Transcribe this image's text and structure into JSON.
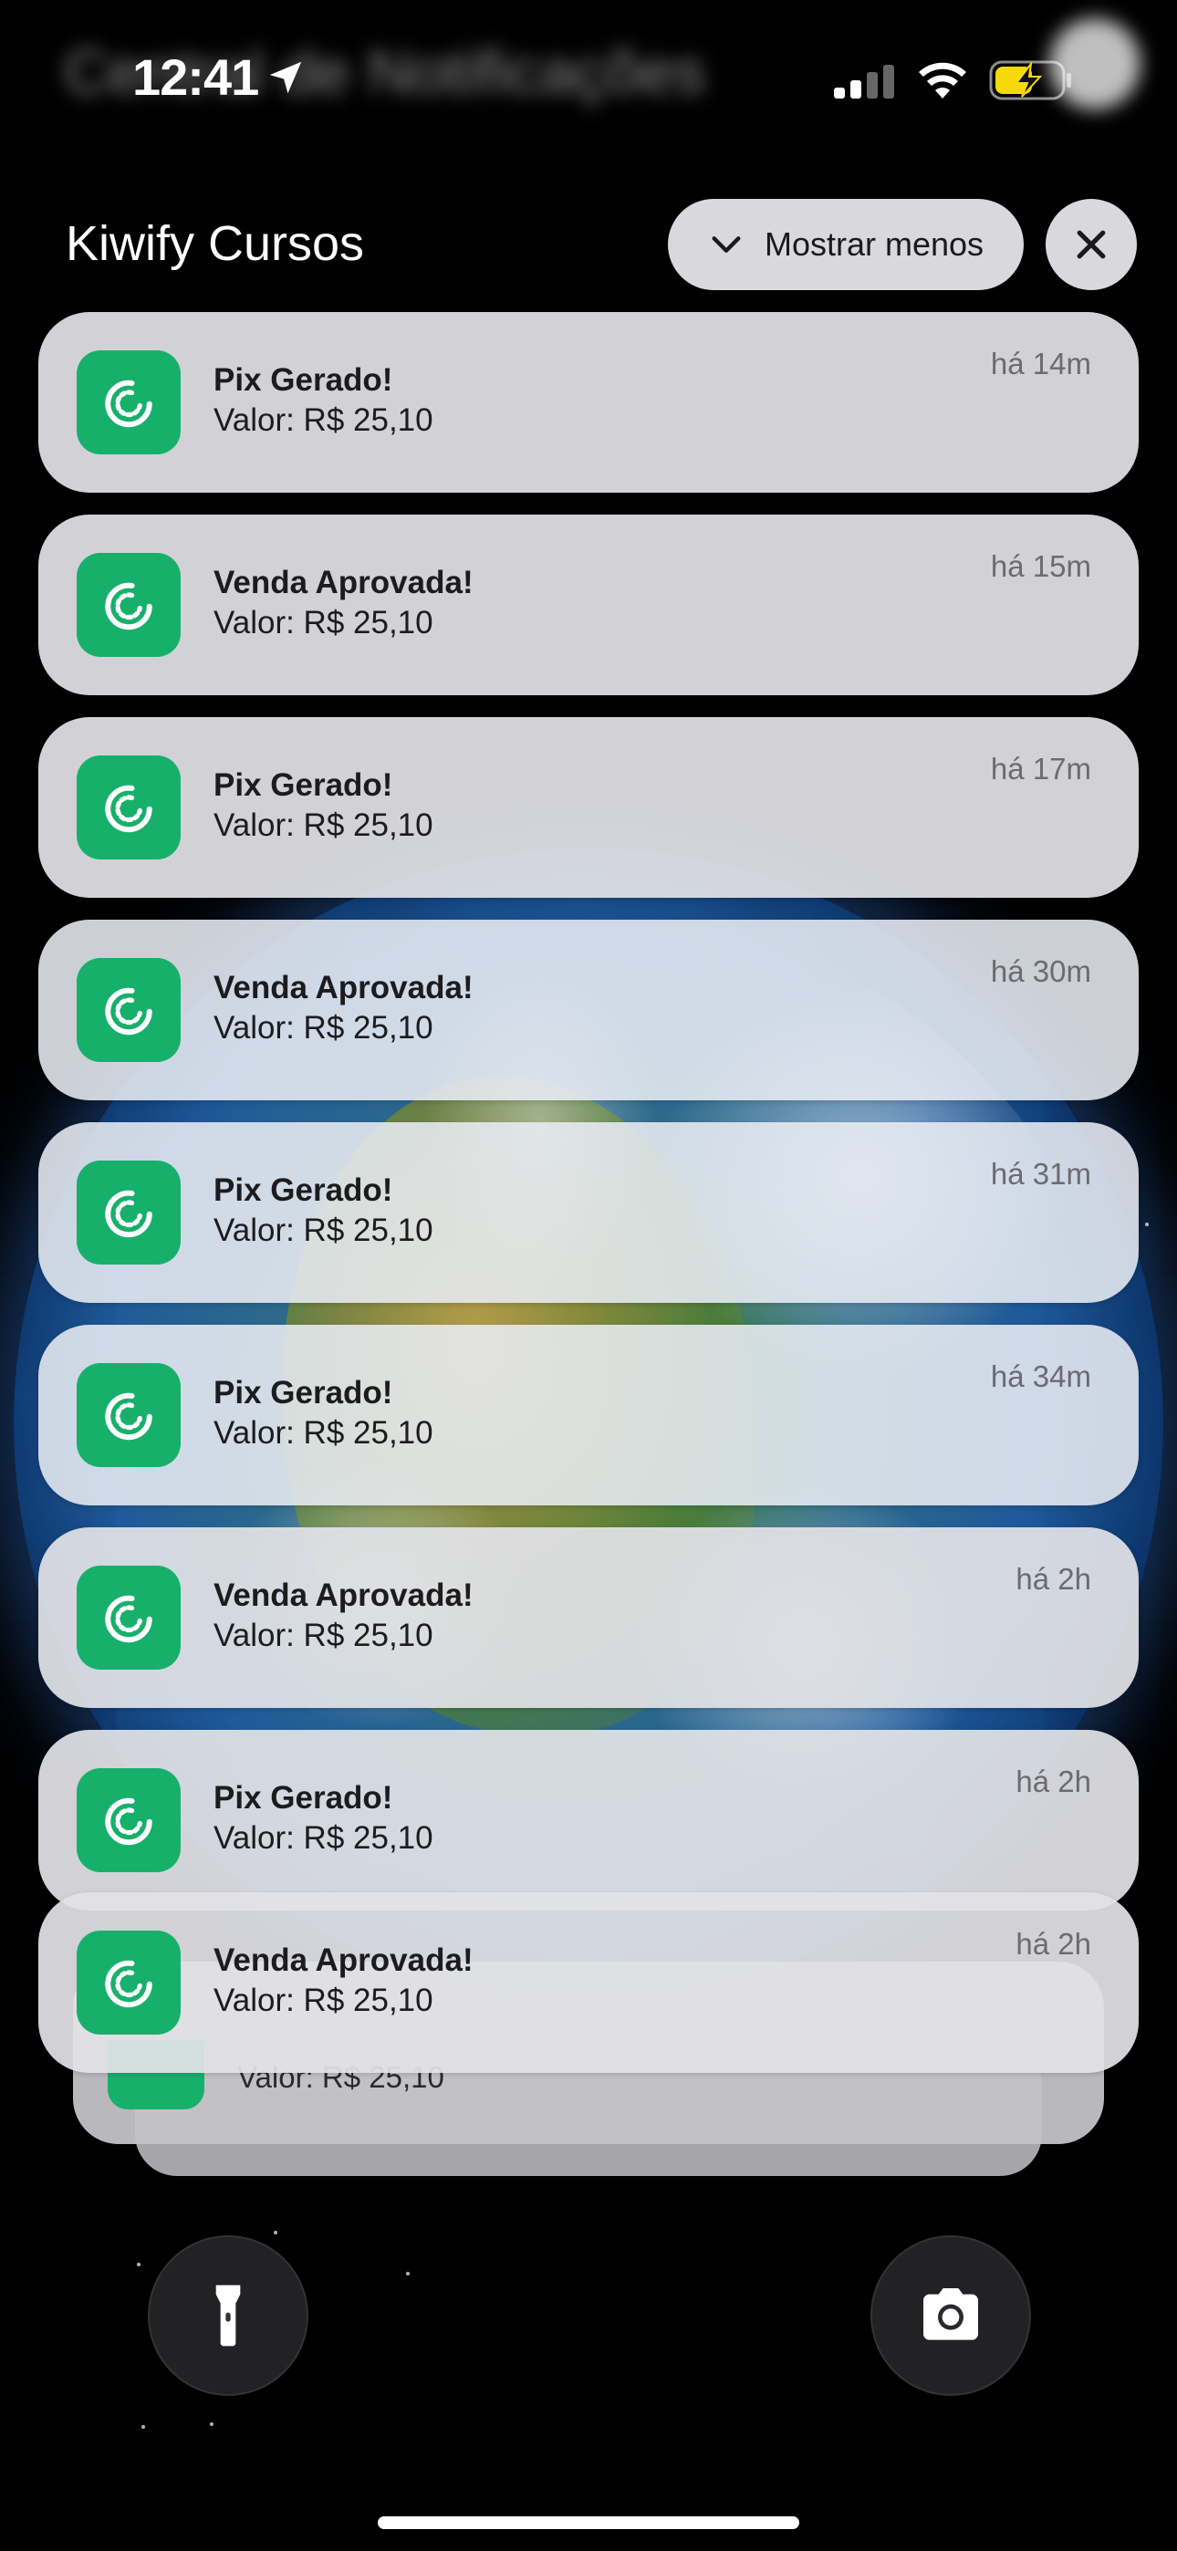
{
  "status_bar": {
    "time": "12:41",
    "blurred_header": "Central de Notificações"
  },
  "group": {
    "title": "Kiwify Cursos",
    "show_less_label": "Mostrar menos"
  },
  "notifications": [
    {
      "title": "Pix Gerado!",
      "body": "Valor: R$ 25,10",
      "time": "há 14m"
    },
    {
      "title": "Venda Aprovada!",
      "body": "Valor: R$ 25,10",
      "time": "há 15m"
    },
    {
      "title": "Pix Gerado!",
      "body": "Valor: R$ 25,10",
      "time": "há 17m"
    },
    {
      "title": "Venda Aprovada!",
      "body": "Valor: R$ 25,10",
      "time": "há 30m"
    },
    {
      "title": "Pix Gerado!",
      "body": "Valor: R$ 25,10",
      "time": "há 31m"
    },
    {
      "title": "Pix Gerado!",
      "body": "Valor: R$ 25,10",
      "time": "há 34m"
    },
    {
      "title": "Venda Aprovada!",
      "body": "Valor: R$ 25,10",
      "time": "há 2h"
    },
    {
      "title": "Pix Gerado!",
      "body": "Valor: R$ 25,10",
      "time": "há 2h"
    },
    {
      "title": "Venda Aprovada!",
      "body": "Valor: R$ 25,10",
      "time": "há 2h"
    }
  ],
  "stacked_peek": {
    "body": "Valor: R$ 25,10"
  },
  "colors": {
    "app_icon": "#17b06b",
    "card": "#e2e2e6"
  },
  "icons": {
    "app": "kiwify-logo-icon",
    "flashlight": "flashlight-icon",
    "camera": "camera-icon"
  }
}
